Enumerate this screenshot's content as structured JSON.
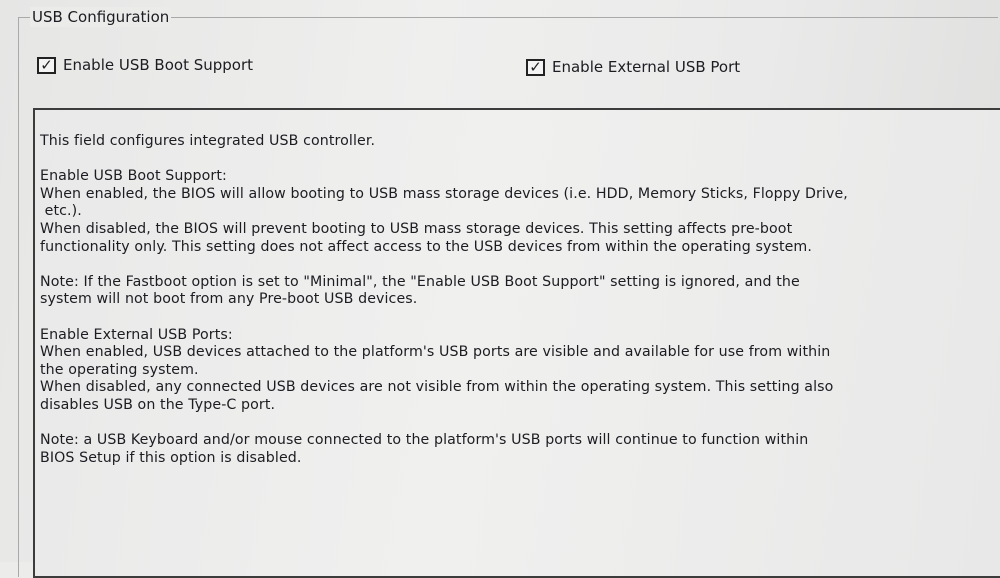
{
  "group_title": "USB Configuration",
  "options": [
    {
      "label": "Enable USB Boot Support",
      "checked": true
    },
    {
      "label": "Enable External USB Port",
      "checked": true
    }
  ],
  "check_glyph": "✓",
  "help": {
    "intro": "This field configures integrated USB controller.",
    "boot_heading": "Enable USB Boot Support:",
    "boot_enabled_line1": "When enabled, the BIOS will allow booting to USB mass storage devices (i.e. HDD, Memory Sticks, Floppy Drive,",
    "boot_enabled_line2": " etc.).",
    "boot_disabled_line1": "When disabled, the BIOS will prevent booting to USB mass storage devices. This setting affects pre-boot",
    "boot_disabled_line2": "functionality only. This setting does not affect access to the USB devices from within the operating system.",
    "note1_line1": "Note:  If the Fastboot option is set to \"Minimal\", the \"Enable USB Boot Support\" setting is ignored, and the",
    "note1_line2": "system will not boot from any Pre-boot USB devices.",
    "ext_heading": "Enable External USB Ports:",
    "ext_enabled_line1": "When enabled, USB devices attached to the platform's USB ports are visible and available for use from within",
    "ext_enabled_line2": "the operating system.",
    "ext_disabled_line1": "When disabled, any connected USB devices are not visible from within the operating system. This setting also",
    "ext_disabled_line2": "disables USB on the Type-C port.",
    "note2_line1": "Note: a USB Keyboard and/or mouse connected to the platform's USB ports will continue to function within",
    "note2_line2": "BIOS Setup if this option is disabled."
  }
}
